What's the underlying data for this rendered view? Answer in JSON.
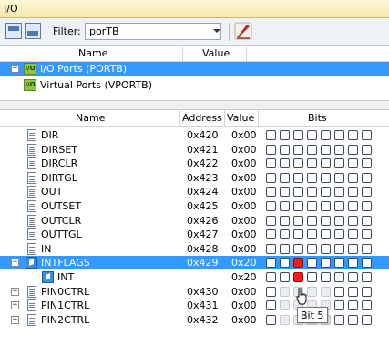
{
  "window": {
    "title": "I/O"
  },
  "toolbar": {
    "filter_label": "Filter:",
    "filter_value": "porTB"
  },
  "top_panel": {
    "headers": {
      "name": "Name",
      "value": "Value"
    },
    "items": [
      {
        "label": "I/O Ports (PORTB)",
        "expander": "+",
        "selected": true
      },
      {
        "label": "Virtual Ports (VPORTB)",
        "expander": "",
        "selected": false
      }
    ]
  },
  "registers": {
    "headers": {
      "name": "Name",
      "address": "Address",
      "value": "Value",
      "bits": "Bits"
    },
    "rows": [
      {
        "name": "DIR",
        "address": "0x420",
        "value": "0x00"
      },
      {
        "name": "DIRSET",
        "address": "0x421",
        "value": "0x00"
      },
      {
        "name": "DIRCLR",
        "address": "0x422",
        "value": "0x00"
      },
      {
        "name": "DIRTGL",
        "address": "0x423",
        "value": "0x00"
      },
      {
        "name": "OUT",
        "address": "0x424",
        "value": "0x00"
      },
      {
        "name": "OUTSET",
        "address": "0x425",
        "value": "0x00"
      },
      {
        "name": "OUTCLR",
        "address": "0x426",
        "value": "0x00"
      },
      {
        "name": "OUTTGL",
        "address": "0x427",
        "value": "0x00"
      },
      {
        "name": "IN",
        "address": "0x428",
        "value": "0x00"
      },
      {
        "name": "INTFLAGS",
        "address": "0x429",
        "value": "0x20"
      },
      {
        "name": "INT",
        "address": "",
        "value": "0x20"
      },
      {
        "name": "PIN0CTRL",
        "address": "0x430",
        "value": "0x00"
      },
      {
        "name": "PIN1CTRL",
        "address": "0x431",
        "value": "0x00"
      },
      {
        "name": "PIN2CTRL",
        "address": "0x432",
        "value": "0x00"
      }
    ]
  },
  "tooltip": {
    "text": "Bit 5"
  },
  "colors": {
    "selection": "#3399ff",
    "bit_set": "#ff1a1a"
  }
}
